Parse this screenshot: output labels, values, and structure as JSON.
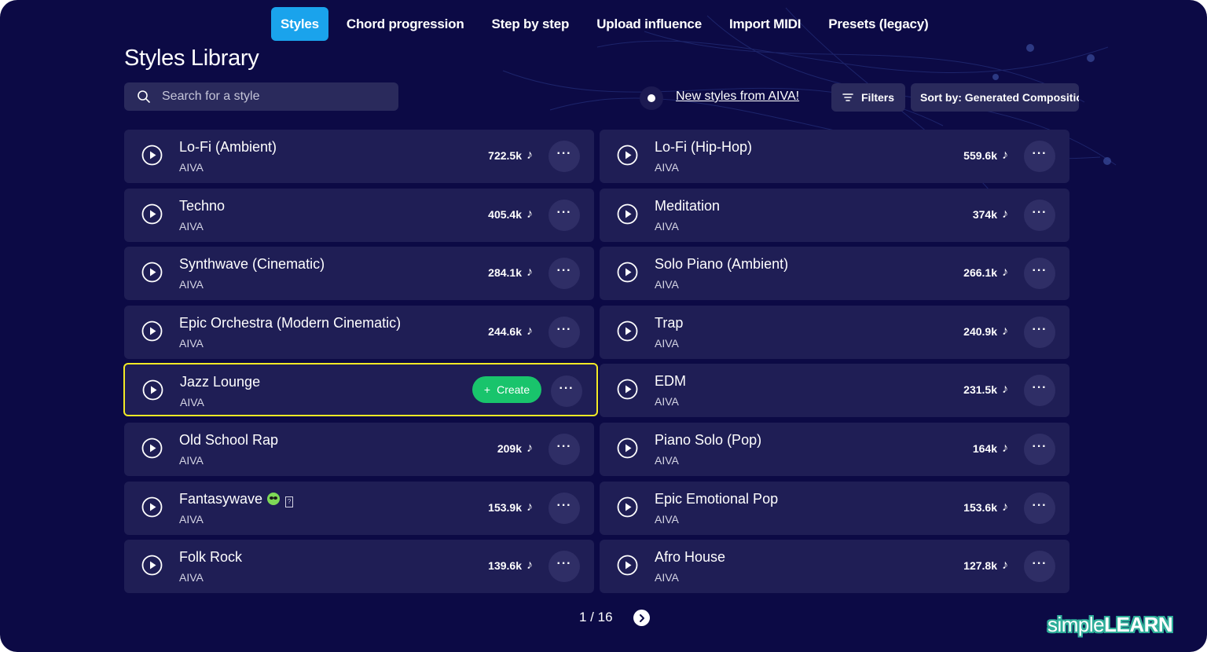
{
  "tabs": [
    {
      "label": "Styles",
      "active": true
    },
    {
      "label": "Chord progression",
      "active": false
    },
    {
      "label": "Step by step",
      "active": false
    },
    {
      "label": "Upload influence",
      "active": false
    },
    {
      "label": "Import MIDI",
      "active": false
    },
    {
      "label": "Presets (legacy)",
      "active": false
    }
  ],
  "page_title": "Styles Library",
  "search": {
    "placeholder": "Search for a style",
    "value": ""
  },
  "news_link": "New styles from AIVA!",
  "filters_label": "Filters",
  "sort_label": "Sort by: Generated Compositions",
  "colors": {
    "background": "#0c0a45",
    "card": "#1f1e55",
    "accent": "#1aa3ec",
    "create": "#19c46c",
    "highlight": "#f2ea25"
  },
  "styles_left": [
    {
      "title": "Lo-Fi (Ambient)",
      "author": "AIVA",
      "count": "722.5k"
    },
    {
      "title": "Techno",
      "author": "AIVA",
      "count": "405.4k"
    },
    {
      "title": "Synthwave (Cinematic)",
      "author": "AIVA",
      "count": "284.1k"
    },
    {
      "title": "Epic Orchestra (Modern Cinematic)",
      "author": "AIVA",
      "count": "244.6k"
    },
    {
      "title": "Jazz Lounge",
      "author": "AIVA",
      "count": "",
      "highlighted": true,
      "create_label": "Create"
    },
    {
      "title": "Old School Rap",
      "author": "AIVA",
      "count": "209k"
    },
    {
      "title": "Fantasywave",
      "author": "AIVA",
      "count": "153.9k",
      "emoji": "alien-icon"
    },
    {
      "title": "Folk Rock",
      "author": "AIVA",
      "count": "139.6k"
    }
  ],
  "styles_right": [
    {
      "title": "Lo-Fi (Hip-Hop)",
      "author": "AIVA",
      "count": "559.6k"
    },
    {
      "title": "Meditation",
      "author": "AIVA",
      "count": "374k"
    },
    {
      "title": "Solo Piano (Ambient)",
      "author": "AIVA",
      "count": "266.1k"
    },
    {
      "title": "Trap",
      "author": "AIVA",
      "count": "240.9k"
    },
    {
      "title": "EDM",
      "author": "AIVA",
      "count": "231.5k"
    },
    {
      "title": "Piano Solo (Pop)",
      "author": "AIVA",
      "count": "164k"
    },
    {
      "title": "Epic Emotional Pop",
      "author": "AIVA",
      "count": "153.6k"
    },
    {
      "title": "Afro House",
      "author": "AIVA",
      "count": "127.8k"
    }
  ],
  "pagination": {
    "label": "1 / 16"
  },
  "watermark": {
    "part1": "simple",
    "part2": "LEARN"
  }
}
